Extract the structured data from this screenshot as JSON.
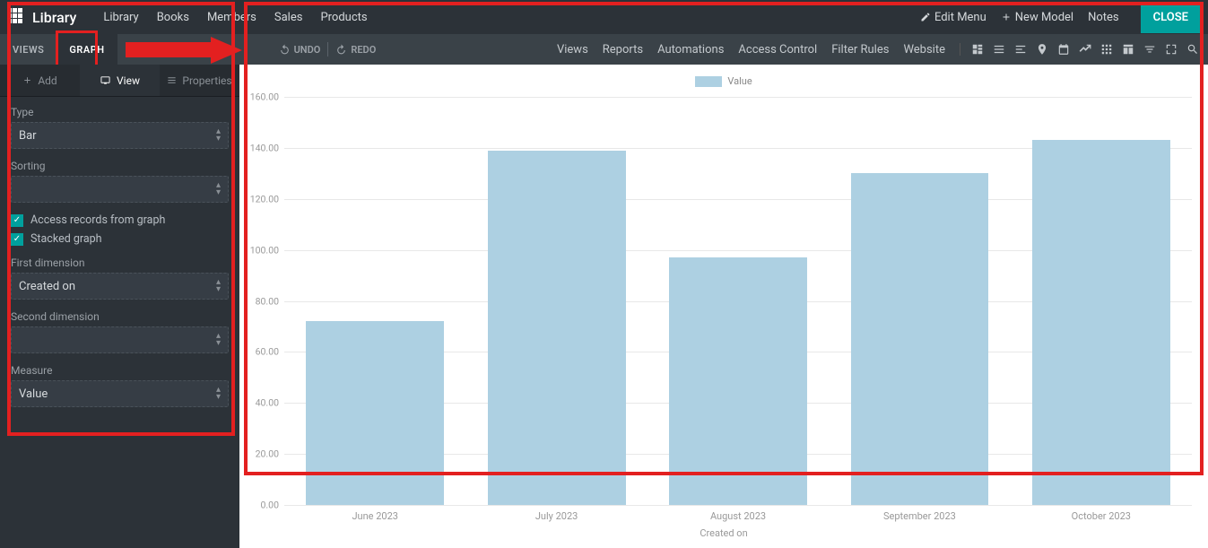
{
  "topbar": {
    "app_title": "Library",
    "nav": [
      "Library",
      "Books",
      "Members",
      "Sales",
      "Products"
    ],
    "edit_menu": "Edit Menu",
    "new_model": "New Model",
    "notes": "Notes",
    "close": "CLOSE"
  },
  "secondbar": {
    "tabs": [
      "VIEWS",
      "GRAPH"
    ],
    "active_tab": "GRAPH",
    "undo": "UNDO",
    "redo": "REDO",
    "links": [
      "Views",
      "Reports",
      "Automations",
      "Access Control",
      "Filter Rules",
      "Website"
    ],
    "icon_names": [
      "layout-icon",
      "list-icon",
      "align-icon",
      "pin-icon",
      "calendar-icon",
      "chart-icon",
      "grid-icon",
      "table-icon",
      "sort-icon",
      "expand-icon",
      "search-icon"
    ]
  },
  "panel": {
    "tabs": {
      "add": "Add",
      "view": "View",
      "properties": "Properties"
    },
    "active": "View",
    "type_label": "Type",
    "type_value": "Bar",
    "sorting_label": "Sorting",
    "sorting_value": "",
    "check_access": "Access records from graph",
    "check_stacked": "Stacked graph",
    "first_dim_label": "First dimension",
    "first_dim_value": "Created on",
    "second_dim_label": "Second dimension",
    "second_dim_value": "",
    "measure_label": "Measure",
    "measure_value": "Value"
  },
  "chart_data": {
    "type": "bar",
    "legend_label": "Value",
    "xlabel": "Created on",
    "categories": [
      "June 2023",
      "July 2023",
      "August 2023",
      "September 2023",
      "October 2023"
    ],
    "values": [
      72,
      139,
      97,
      130,
      143
    ],
    "ymin": 0,
    "ymax": 160,
    "yticks": [
      "160.00",
      "140.00",
      "120.00",
      "100.00",
      "80.00",
      "60.00",
      "40.00",
      "20.00",
      "0.00"
    ],
    "bar_color": "#add0e2"
  }
}
